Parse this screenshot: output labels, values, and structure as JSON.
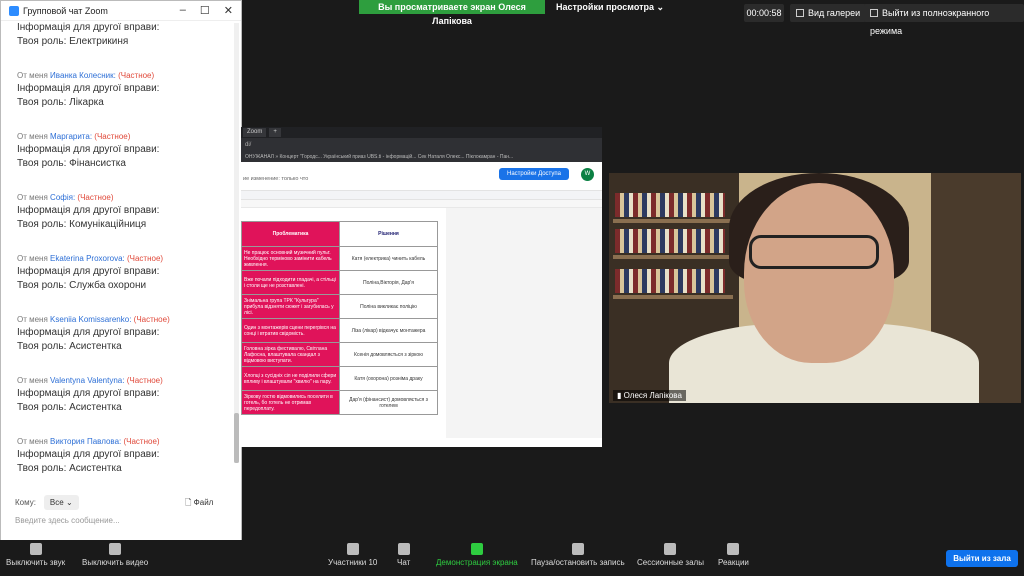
{
  "top": {
    "share_banner": "Вы просматриваете экран Олеся Лапікова",
    "view_settings": "Настройки просмотра ⌄",
    "timer": "00:00:58",
    "gallery": "Вид галереи",
    "exit_fullscreen": "Выйти из полноэкранного режима"
  },
  "chat": {
    "title": "Групповой чат Zoom",
    "first_lines": [
      "Інформація для другої вправи:",
      "Твоя роль: Електрикиня"
    ],
    "messages": [
      {
        "prefix": "От меня",
        "sender": "Иванка Колесник:",
        "priv": "(Частное)",
        "line1": "Інформація для другої вправи:",
        "line2": "Твоя роль: Лікарка"
      },
      {
        "prefix": "От меня",
        "sender": "Маргарита:",
        "priv": "(Частное)",
        "line1": "Інформація для другої вправи:",
        "line2": "Твоя роль: Фінансистка"
      },
      {
        "prefix": "От меня",
        "sender": "Софія:",
        "priv": "(Частное)",
        "line1": "Інформація для другої вправи:",
        "line2": "Твоя роль: Комунікаційниця"
      },
      {
        "prefix": "От меня",
        "sender": "Ekaterina Proxorova:",
        "priv": "(Частное)",
        "line1": "Інформація для другої вправи:",
        "line2": "Твоя роль: Служба охорони"
      },
      {
        "prefix": "От меня",
        "sender": "Kseniia Komissarenko:",
        "priv": "(Частное)",
        "line1": "Інформація для другої вправи:",
        "line2": "Твоя роль: Асистентка"
      },
      {
        "prefix": "От меня",
        "sender": "Valentyna Valentyna:",
        "priv": "(Частное)",
        "line1": "Інформація для другої вправи:",
        "line2": "Твоя роль: Асистентка"
      },
      {
        "prefix": "От меня",
        "sender": "Виктория Павлова:",
        "priv": "(Частное)",
        "line1": "Інформація для другої вправи:",
        "line2": "Твоя роль: Асистентка"
      }
    ],
    "to_label": "Кому:",
    "to_value": "Все",
    "file_label": "Файл",
    "input_placeholder": "Введите здесь сообщение..."
  },
  "share": {
    "bookmarks": "ОНУЖАНАЛ »   Концерт \"Городс...   Український приаз   UBS.ti - інформацій...   Сек Наталя Олекс...   Піклокамран - Пан...",
    "note": "ие изменение: только что",
    "access_button": "Настройки Доступа",
    "avatar": "W",
    "table": {
      "h_problem": "Проблематика",
      "h_solution": "Рішення",
      "rows": [
        {
          "problem": "Не працює основний музичний пульт. Необхідно терміново замінити кабель живлення.",
          "solution": "Катя (електрика) чинить кабель"
        },
        {
          "problem": "Вже почали підходити гладачі, а стільці і столи ще не розставлені.",
          "solution": "Поліна,Вікторія, Дар'я"
        },
        {
          "problem": "Знімальна група ТРК \"Культура\" прибула відзняти сюжет і загубилась у лісі.",
          "solution": "Поліна викликає поліцію"
        },
        {
          "problem": "Один з монтажерів сцени перегрівся на сонці і втратив свідомість.",
          "solution": "Ліза (лікар) відкачує монтажера"
        },
        {
          "problem": "Головна зірка фестивалю, Світлана Лафосна, влаштувала скандал з відмовою виступати.",
          "solution": "Ксенія домовляється з зіркою"
        },
        {
          "problem": "Хлопці з сусідніх сіл не поділили сфери впливу і влаштували \"хвилю\" на пару.",
          "solution": "Катя (охорона) розніма драку"
        },
        {
          "problem": "Зіркову гостю відмовились поселити в готель, бо готель не отримав передоплату.",
          "solution": "Дар'я (фінансист) домовляється з готелем"
        }
      ]
    }
  },
  "video": {
    "name": "Олеся Лапікова"
  },
  "bottom": {
    "mute": "Выключить звук",
    "video": "Выключить видео",
    "participants": "Участники",
    "participants_count": "10",
    "chat": "Чат",
    "share_screen": "Демонстрация экрана",
    "record": "Пауза/остановить запись",
    "breakout": "Сессионные залы",
    "reactions": "Реакции",
    "leave": "Выйти из зала"
  }
}
